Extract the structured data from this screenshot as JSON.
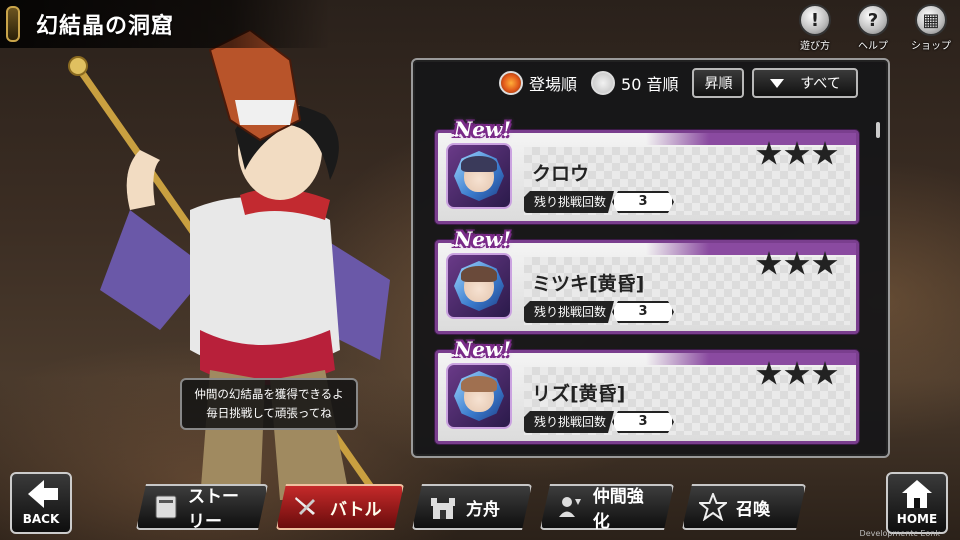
{
  "header": {
    "title": "幻結晶の洞窟"
  },
  "top_icons": [
    {
      "label": "遊び方",
      "icon": "exclamation-icon",
      "glyph": "!"
    },
    {
      "label": "ヘルプ",
      "icon": "question-icon",
      "glyph": "?"
    },
    {
      "label": "ショップ",
      "icon": "shop-icon",
      "glyph": "▦"
    }
  ],
  "speech": {
    "line1": "仲間の幻結晶を獲得できるよ",
    "line2": "毎日挑戦して頑張ってね"
  },
  "sort": {
    "option1": "登場順",
    "option1_selected": true,
    "option2": "50 音順",
    "option2_selected": false,
    "order_button": "昇順",
    "filter_button": "すべて"
  },
  "cards": [
    {
      "badge": "New!",
      "name": "クロウ",
      "stars": 3,
      "challenge_label": "残り挑戦回数",
      "challenge_value": "3",
      "hair": "#3a3a5a"
    },
    {
      "badge": "New!",
      "name": "ミツキ[黄昏]",
      "stars": 3,
      "challenge_label": "残り挑戦回数",
      "challenge_value": "3",
      "hair": "#6a4a3a"
    },
    {
      "badge": "New!",
      "name": "リズ[黄昏]",
      "stars": 3,
      "challenge_label": "残り挑戦回数",
      "challenge_value": "3",
      "hair": "#a07050"
    }
  ],
  "nav": {
    "back": "BACK",
    "home": "HOME",
    "items": [
      {
        "label": "ストーリー",
        "icon": "book-icon",
        "active": false
      },
      {
        "label": "バトル",
        "icon": "sword-icon",
        "active": true
      },
      {
        "label": "方舟",
        "icon": "castle-icon",
        "active": false
      },
      {
        "label": "仲間強化",
        "icon": "party-icon",
        "active": false
      },
      {
        "label": "召喚",
        "icon": "star-icon",
        "active": false
      }
    ]
  },
  "watermark": "Developmentc Eonk",
  "colors": {
    "accent_purple": "#7a3e8e",
    "active_red": "#c52a2a",
    "radio_orange": "#e0571a"
  }
}
